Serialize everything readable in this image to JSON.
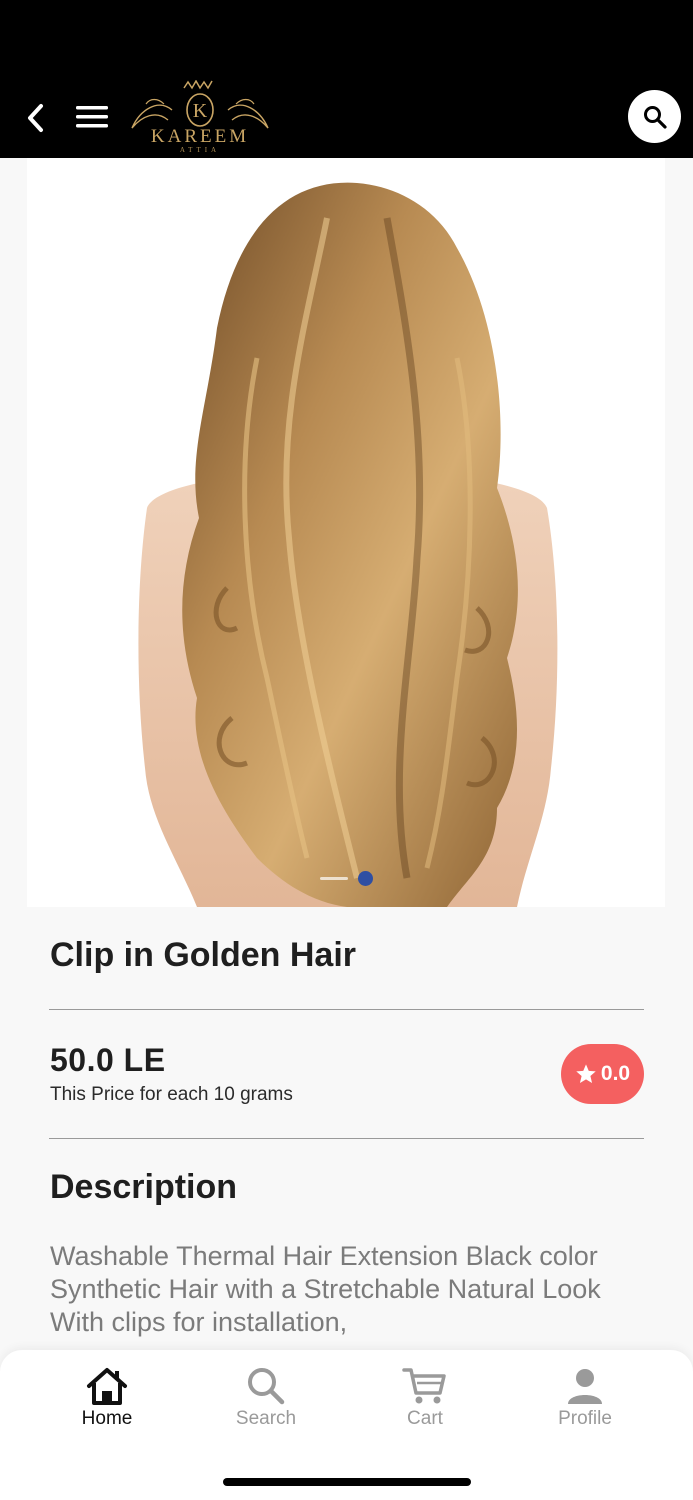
{
  "header": {
    "back_icon": "chevron-left-icon",
    "menu_icon": "hamburger-menu-icon",
    "logo_letter": "K",
    "logo_name": "KAREEM",
    "logo_sub": "ATTIA",
    "search_icon": "search-icon"
  },
  "product": {
    "image_alt": "long golden wavy hair from behind",
    "carousel": {
      "count": 2,
      "active_index": 1
    },
    "title": "Clip in Golden Hair",
    "price": "50.0 LE",
    "price_note": "This Price for each 10 grams",
    "rating": "0.0",
    "rating_color": "#f46060"
  },
  "description": {
    "heading": "Description",
    "text": "Washable Thermal Hair Extension Black color Synthetic Hair with a Stretchable Natural Look With clips for installation,"
  },
  "bottom_nav": {
    "items": [
      {
        "label": "Home",
        "icon": "home-icon",
        "active": true
      },
      {
        "label": "Search",
        "icon": "search-icon",
        "active": false
      },
      {
        "label": "Cart",
        "icon": "cart-icon",
        "active": false
      },
      {
        "label": "Profile",
        "icon": "profile-icon",
        "active": false
      }
    ]
  },
  "colors": {
    "accent_dot": "#2f4fa3",
    "logo_gold": "#c9a564"
  }
}
